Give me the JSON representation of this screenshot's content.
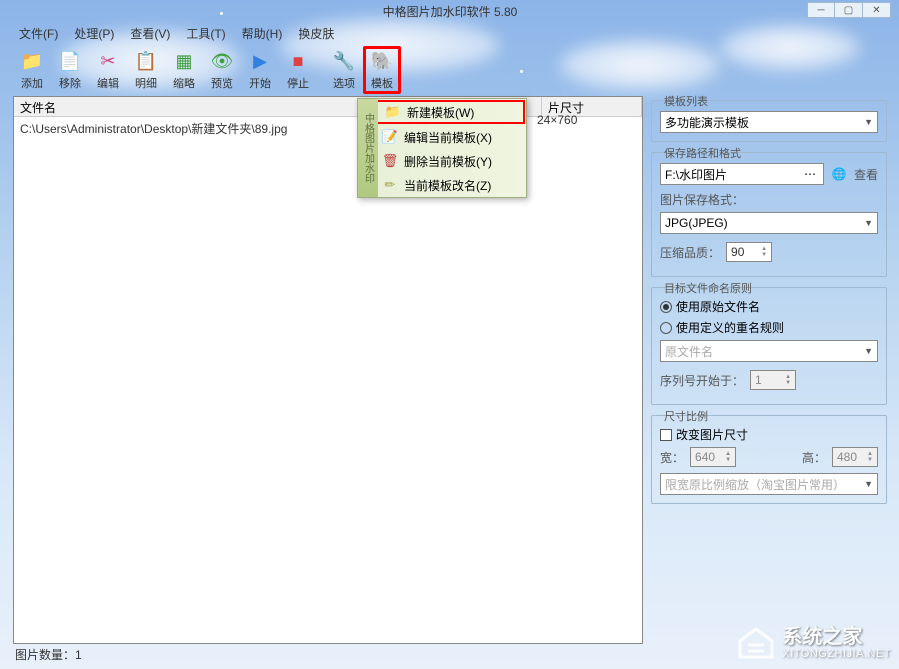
{
  "title": "中格图片加水印软件 5.80",
  "menubar": [
    "文件(F)",
    "处理(P)",
    "查看(V)",
    "工具(T)",
    "帮助(H)",
    "换皮肤"
  ],
  "toolbar": [
    {
      "label": "添加",
      "glyph": "📁"
    },
    {
      "label": "移除",
      "glyph": "📄"
    },
    {
      "label": "编辑",
      "glyph": "✂"
    },
    {
      "label": "明细",
      "glyph": "📋"
    },
    {
      "label": "缩略",
      "glyph": "▦"
    },
    {
      "label": "预览",
      "glyph": "👁"
    },
    {
      "label": "开始",
      "glyph": "▶"
    },
    {
      "label": "停止",
      "glyph": "■"
    },
    {
      "label": "选项",
      "glyph": "🔧"
    },
    {
      "label": "模板",
      "glyph": "🐘"
    }
  ],
  "file_header": {
    "name": "文件名",
    "size": "片尺寸"
  },
  "file_rows": [
    {
      "name": "C:\\Users\\Administrator\\Desktop\\新建文件夹\\89.jpg",
      "size": "24×760"
    }
  ],
  "dropdown": {
    "sidebar": "中格图片加水印",
    "items": [
      "新建模板(W)",
      "编辑当前模板(X)",
      "删除当前模板(Y)",
      "当前模板改名(Z)"
    ]
  },
  "right": {
    "template_list": {
      "title": "模板列表",
      "value": "多功能演示模板"
    },
    "save": {
      "title": "保存路径和格式",
      "path": "F:\\水印图片",
      "view": "查看",
      "format_label": "图片保存格式：",
      "format_value": "JPG(JPEG)",
      "quality_label": "压缩品质：",
      "quality_value": "90"
    },
    "naming": {
      "title": "目标文件命名原则",
      "opt1": "使用原始文件名",
      "opt2": "使用定义的重名规则",
      "placeholder": "原文件名",
      "seq_label": "序列号开始于：",
      "seq_value": "1"
    },
    "dim": {
      "title": "尺寸比例",
      "change": "改变图片尺寸",
      "width_label": "宽：",
      "width_value": "640",
      "height_label": "高：",
      "height_value": "480",
      "constrain": "限宽原比例缩放（淘宝图片常用）"
    }
  },
  "statusbar": "图片数量：1",
  "watermark": {
    "big": "系统之家",
    "small": "XITONGZHIJIA.NET"
  }
}
